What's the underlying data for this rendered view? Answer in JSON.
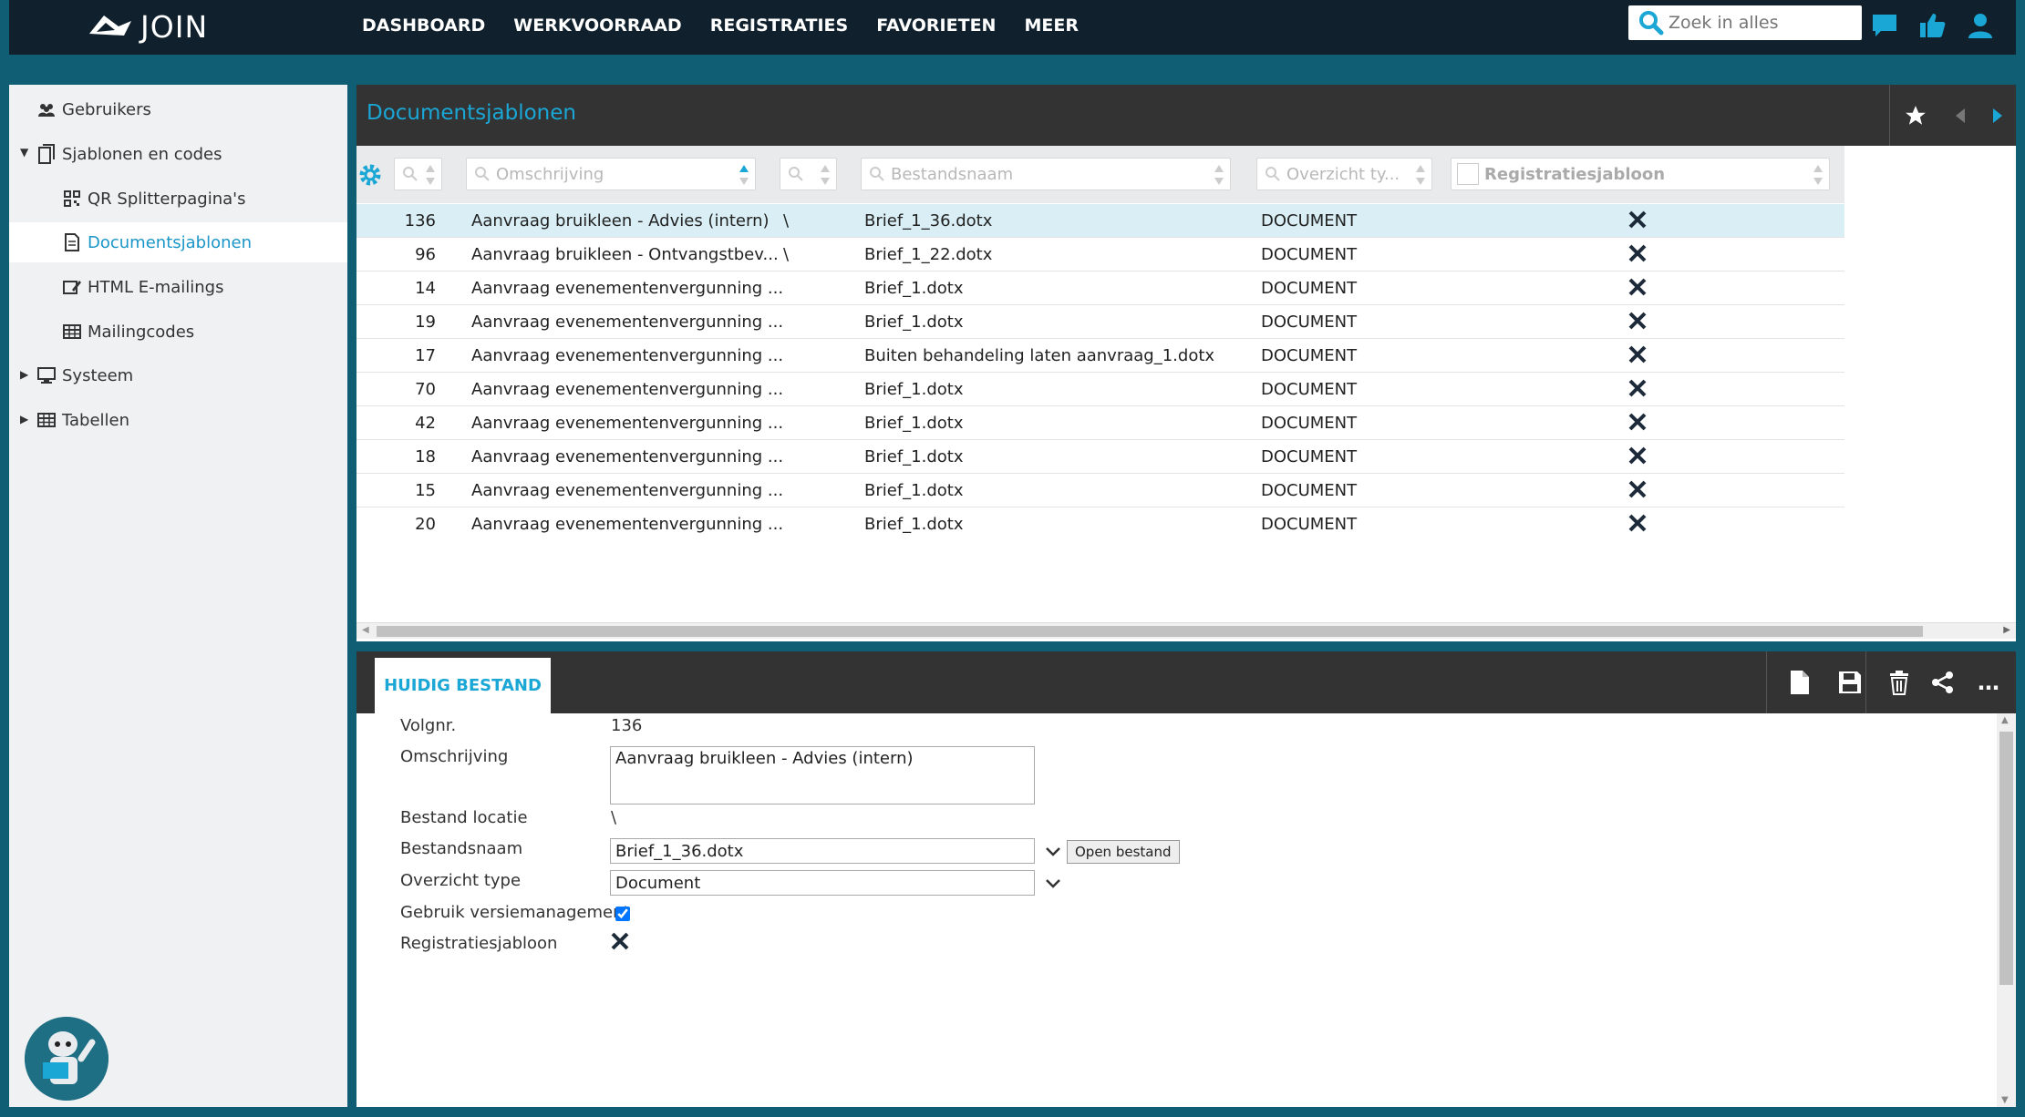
{
  "app": {
    "name": "JOIN"
  },
  "nav": [
    "DASHBOARD",
    "WERKVOORRAAD",
    "REGISTRATIES",
    "FAVORIETEN",
    "MEER"
  ],
  "search": {
    "placeholder": "Zoek in alles"
  },
  "sidebar": {
    "items": [
      {
        "label": "Gebruikers",
        "icon": "users-icon"
      },
      {
        "label": "Sjablonen en codes",
        "icon": "document-copy-icon",
        "expanded": true
      },
      {
        "label": "QR Splitterpagina's",
        "icon": "qr-icon"
      },
      {
        "label": "Documentsjablonen",
        "icon": "document-icon",
        "active": true
      },
      {
        "label": "HTML E-mailings",
        "icon": "email-edit-icon"
      },
      {
        "label": "Mailingcodes",
        "icon": "table-icon"
      },
      {
        "label": "Systeem",
        "icon": "monitor-icon",
        "expanded": false
      },
      {
        "label": "Tabellen",
        "icon": "table-icon",
        "expanded": false
      }
    ]
  },
  "main": {
    "title": "Documentsjablonen",
    "filters": {
      "omschrijving": "Omschrijving",
      "bestandsnaam": "Bestandsnaam",
      "overzicht": "Overzicht ty...",
      "registratiesjabloon": "Registratiesjabloon"
    },
    "rows": [
      {
        "id": "136",
        "omschrijving": "Aanvraag bruikleen - Advies (intern)",
        "locatie": "\\",
        "bestandsnaam": "Brief_1_36.dotx",
        "type": "DOCUMENT",
        "selected": true
      },
      {
        "id": "96",
        "omschrijving": "Aanvraag bruikleen - Ontvangstbev...",
        "locatie": "\\",
        "bestandsnaam": "Brief_1_22.dotx",
        "type": "DOCUMENT"
      },
      {
        "id": "14",
        "omschrijving": "Aanvraag evenementenvergunning ...",
        "locatie": "",
        "bestandsnaam": "Brief_1.dotx",
        "type": "DOCUMENT"
      },
      {
        "id": "19",
        "omschrijving": "Aanvraag evenementenvergunning ...",
        "locatie": "",
        "bestandsnaam": "Brief_1.dotx",
        "type": "DOCUMENT"
      },
      {
        "id": "17",
        "omschrijving": "Aanvraag evenementenvergunning ...",
        "locatie": "",
        "bestandsnaam": "Buiten behandeling laten aanvraag_1.dotx",
        "type": "DOCUMENT"
      },
      {
        "id": "70",
        "omschrijving": "Aanvraag evenementenvergunning ...",
        "locatie": "",
        "bestandsnaam": "Brief_1.dotx",
        "type": "DOCUMENT"
      },
      {
        "id": "42",
        "omschrijving": "Aanvraag evenementenvergunning ...",
        "locatie": "",
        "bestandsnaam": "Brief_1.dotx",
        "type": "DOCUMENT"
      },
      {
        "id": "18",
        "omschrijving": "Aanvraag evenementenvergunning ...",
        "locatie": "",
        "bestandsnaam": "Brief_1.dotx",
        "type": "DOCUMENT"
      },
      {
        "id": "15",
        "omschrijving": "Aanvraag evenementenvergunning ...",
        "locatie": "",
        "bestandsnaam": "Brief_1.dotx",
        "type": "DOCUMENT"
      },
      {
        "id": "20",
        "omschrijving": "Aanvraag evenementenvergunning ...",
        "locatie": "",
        "bestandsnaam": "Brief_1.dotx",
        "type": "DOCUMENT"
      }
    ]
  },
  "detail": {
    "tab": "HUIDIG BESTAND",
    "labels": {
      "volgnr": "Volgnr.",
      "omschrijving": "Omschrijving",
      "locatie": "Bestand locatie",
      "bestandsnaam": "Bestandsnaam",
      "overzicht": "Overzicht type",
      "versie": "Gebruik versiemanagement",
      "registratiesjabloon": "Registratiesjabloon"
    },
    "values": {
      "volgnr": "136",
      "omschrijving": "Aanvraag bruikleen - Advies (intern)",
      "locatie": "\\",
      "bestandsnaam": "Brief_1_36.dotx",
      "overzicht": "Document",
      "versie_checked": true
    },
    "open_button": "Open bestand"
  },
  "colors": {
    "accent": "#1aa7d6",
    "topbar": "#10212d",
    "frame": "#0f5e73",
    "header": "#333333"
  }
}
